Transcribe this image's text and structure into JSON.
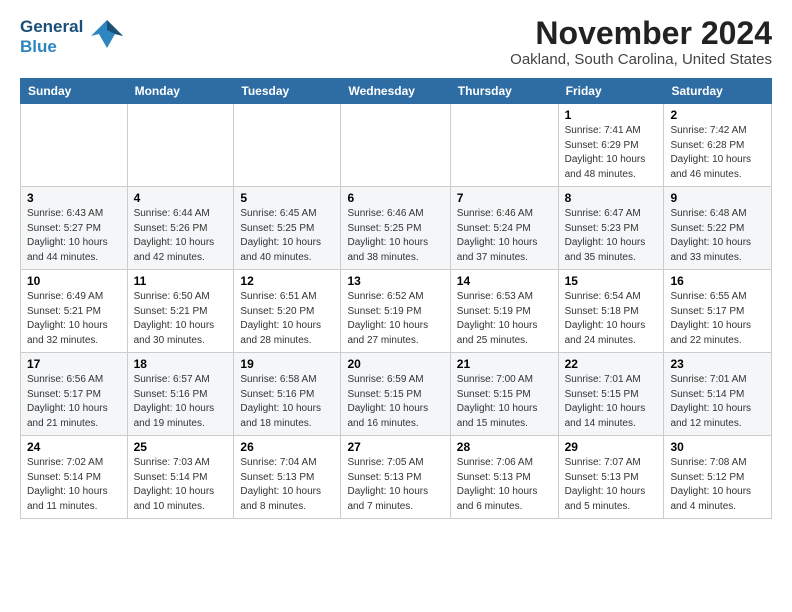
{
  "logo": {
    "line1": "General",
    "line2": "Blue"
  },
  "title": "November 2024",
  "subtitle": "Oakland, South Carolina, United States",
  "weekdays": [
    "Sunday",
    "Monday",
    "Tuesday",
    "Wednesday",
    "Thursday",
    "Friday",
    "Saturday"
  ],
  "weeks": [
    [
      {
        "day": "",
        "info": ""
      },
      {
        "day": "",
        "info": ""
      },
      {
        "day": "",
        "info": ""
      },
      {
        "day": "",
        "info": ""
      },
      {
        "day": "",
        "info": ""
      },
      {
        "day": "1",
        "info": "Sunrise: 7:41 AM\nSunset: 6:29 PM\nDaylight: 10 hours\nand 48 minutes."
      },
      {
        "day": "2",
        "info": "Sunrise: 7:42 AM\nSunset: 6:28 PM\nDaylight: 10 hours\nand 46 minutes."
      }
    ],
    [
      {
        "day": "3",
        "info": "Sunrise: 6:43 AM\nSunset: 5:27 PM\nDaylight: 10 hours\nand 44 minutes."
      },
      {
        "day": "4",
        "info": "Sunrise: 6:44 AM\nSunset: 5:26 PM\nDaylight: 10 hours\nand 42 minutes."
      },
      {
        "day": "5",
        "info": "Sunrise: 6:45 AM\nSunset: 5:25 PM\nDaylight: 10 hours\nand 40 minutes."
      },
      {
        "day": "6",
        "info": "Sunrise: 6:46 AM\nSunset: 5:25 PM\nDaylight: 10 hours\nand 38 minutes."
      },
      {
        "day": "7",
        "info": "Sunrise: 6:46 AM\nSunset: 5:24 PM\nDaylight: 10 hours\nand 37 minutes."
      },
      {
        "day": "8",
        "info": "Sunrise: 6:47 AM\nSunset: 5:23 PM\nDaylight: 10 hours\nand 35 minutes."
      },
      {
        "day": "9",
        "info": "Sunrise: 6:48 AM\nSunset: 5:22 PM\nDaylight: 10 hours\nand 33 minutes."
      }
    ],
    [
      {
        "day": "10",
        "info": "Sunrise: 6:49 AM\nSunset: 5:21 PM\nDaylight: 10 hours\nand 32 minutes."
      },
      {
        "day": "11",
        "info": "Sunrise: 6:50 AM\nSunset: 5:21 PM\nDaylight: 10 hours\nand 30 minutes."
      },
      {
        "day": "12",
        "info": "Sunrise: 6:51 AM\nSunset: 5:20 PM\nDaylight: 10 hours\nand 28 minutes."
      },
      {
        "day": "13",
        "info": "Sunrise: 6:52 AM\nSunset: 5:19 PM\nDaylight: 10 hours\nand 27 minutes."
      },
      {
        "day": "14",
        "info": "Sunrise: 6:53 AM\nSunset: 5:19 PM\nDaylight: 10 hours\nand 25 minutes."
      },
      {
        "day": "15",
        "info": "Sunrise: 6:54 AM\nSunset: 5:18 PM\nDaylight: 10 hours\nand 24 minutes."
      },
      {
        "day": "16",
        "info": "Sunrise: 6:55 AM\nSunset: 5:17 PM\nDaylight: 10 hours\nand 22 minutes."
      }
    ],
    [
      {
        "day": "17",
        "info": "Sunrise: 6:56 AM\nSunset: 5:17 PM\nDaylight: 10 hours\nand 21 minutes."
      },
      {
        "day": "18",
        "info": "Sunrise: 6:57 AM\nSunset: 5:16 PM\nDaylight: 10 hours\nand 19 minutes."
      },
      {
        "day": "19",
        "info": "Sunrise: 6:58 AM\nSunset: 5:16 PM\nDaylight: 10 hours\nand 18 minutes."
      },
      {
        "day": "20",
        "info": "Sunrise: 6:59 AM\nSunset: 5:15 PM\nDaylight: 10 hours\nand 16 minutes."
      },
      {
        "day": "21",
        "info": "Sunrise: 7:00 AM\nSunset: 5:15 PM\nDaylight: 10 hours\nand 15 minutes."
      },
      {
        "day": "22",
        "info": "Sunrise: 7:01 AM\nSunset: 5:15 PM\nDaylight: 10 hours\nand 14 minutes."
      },
      {
        "day": "23",
        "info": "Sunrise: 7:01 AM\nSunset: 5:14 PM\nDaylight: 10 hours\nand 12 minutes."
      }
    ],
    [
      {
        "day": "24",
        "info": "Sunrise: 7:02 AM\nSunset: 5:14 PM\nDaylight: 10 hours\nand 11 minutes."
      },
      {
        "day": "25",
        "info": "Sunrise: 7:03 AM\nSunset: 5:14 PM\nDaylight: 10 hours\nand 10 minutes."
      },
      {
        "day": "26",
        "info": "Sunrise: 7:04 AM\nSunset: 5:13 PM\nDaylight: 10 hours\nand 8 minutes."
      },
      {
        "day": "27",
        "info": "Sunrise: 7:05 AM\nSunset: 5:13 PM\nDaylight: 10 hours\nand 7 minutes."
      },
      {
        "day": "28",
        "info": "Sunrise: 7:06 AM\nSunset: 5:13 PM\nDaylight: 10 hours\nand 6 minutes."
      },
      {
        "day": "29",
        "info": "Sunrise: 7:07 AM\nSunset: 5:13 PM\nDaylight: 10 hours\nand 5 minutes."
      },
      {
        "day": "30",
        "info": "Sunrise: 7:08 AM\nSunset: 5:12 PM\nDaylight: 10 hours\nand 4 minutes."
      }
    ]
  ]
}
